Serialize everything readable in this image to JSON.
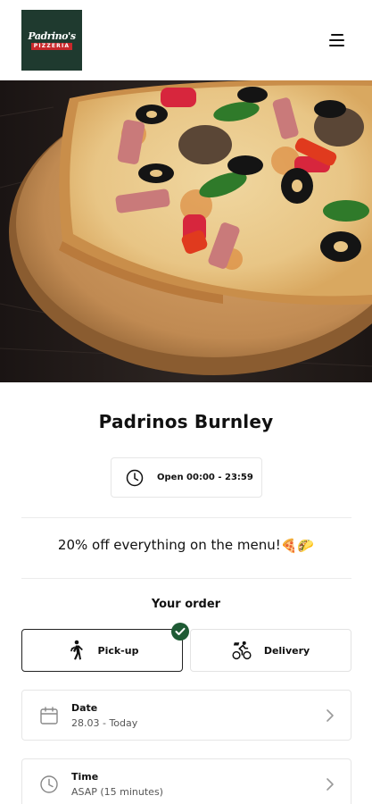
{
  "header": {
    "logo_line1": "Padrino's",
    "logo_line2": "PIZZERIA",
    "menu_icon": "hamburger-menu-icon"
  },
  "hero": {
    "subject": "pizza"
  },
  "restaurant": {
    "name": "Padrinos Burnley",
    "hours": "Open 00:00 - 23:59"
  },
  "promo": {
    "text": "20% off everything on the menu!",
    "emojis": "🍕🌮"
  },
  "order": {
    "heading": "Your order",
    "options": [
      {
        "label": "Pick-up",
        "icon": "walking-person-icon",
        "selected": true
      },
      {
        "label": "Delivery",
        "icon": "cyclist-icon",
        "selected": false
      }
    ],
    "date": {
      "label": "Date",
      "value": "28.03 - Today",
      "icon": "calendar-icon"
    },
    "time": {
      "label": "Time",
      "value": "ASAP (15 minutes)",
      "icon": "clock-icon"
    }
  },
  "colors": {
    "accent_green": "#1e5a34",
    "logo_bg": "#1f3a2f",
    "logo_red": "#c8282b"
  }
}
